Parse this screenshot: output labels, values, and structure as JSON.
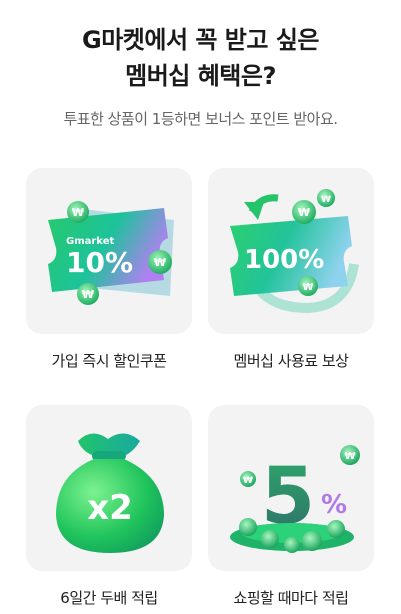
{
  "header": {
    "title_line1": "G마켓에서 꼭 받고 싶은",
    "title_line2": "멤버십 혜택은?",
    "subtitle": "투표한 상품이 1등하면 보너스 포인트 받아요."
  },
  "options": [
    {
      "label": "가입 즉시 할인쿠폰",
      "brand": "Gmarket",
      "value_text": "10%",
      "icon": "coupon-ticket-icon"
    },
    {
      "label": "멤버십 사용료 보상",
      "value_text": "100%",
      "icon": "refund-ticket-icon"
    },
    {
      "label": "6일간 두배 적립",
      "value_text": "x2",
      "icon": "money-bag-icon"
    },
    {
      "label": "쇼핑할 때마다 적립",
      "value_text": "5",
      "value_suffix": "%",
      "icon": "coin-pile-icon"
    }
  ],
  "colors": {
    "accent_green": "#2fd36b",
    "teal": "#1fb59a",
    "purple": "#b06cf0",
    "tile_bg": "#f3f3f3"
  }
}
